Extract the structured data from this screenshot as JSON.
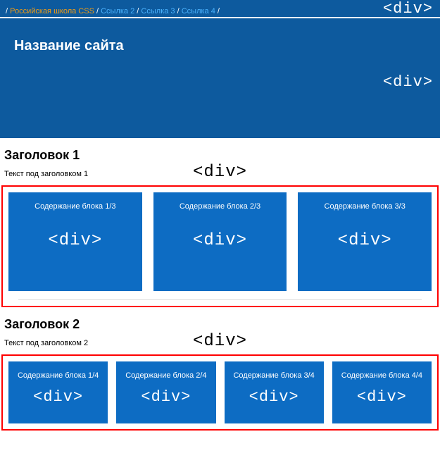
{
  "nav": {
    "links": [
      {
        "text": "Российская школа CSS",
        "cls": "orange"
      },
      {
        "text": "Ссылка 2",
        "cls": "blue"
      },
      {
        "text": "Ссылка 3",
        "cls": "blue"
      },
      {
        "text": "Ссылка 4",
        "cls": "blue"
      }
    ],
    "tag": "<div>"
  },
  "header": {
    "title": "Название сайта",
    "tag": "<div>"
  },
  "section1": {
    "heading": "Заголовок 1",
    "subtitle": "Текст под заголовком 1",
    "tag": "<div>",
    "blocks": [
      {
        "label": "Содержание блока 1/3",
        "tag": "<div>"
      },
      {
        "label": "Содержание блока 2/3",
        "tag": "<div>"
      },
      {
        "label": "Содержание блока 3/3",
        "tag": "<div>"
      }
    ]
  },
  "section2": {
    "heading": "Заголовок 2",
    "subtitle": "Текст под заголовком 2",
    "tag": "<div>",
    "blocks": [
      {
        "label": "Содержание блока 1/4",
        "tag": "<div>"
      },
      {
        "label": "Содержание блока 2/4",
        "tag": "<div>"
      },
      {
        "label": "Содержание блока 3/4",
        "tag": "<div>"
      },
      {
        "label": "Содержание блока 4/4",
        "tag": "<div>"
      }
    ]
  }
}
